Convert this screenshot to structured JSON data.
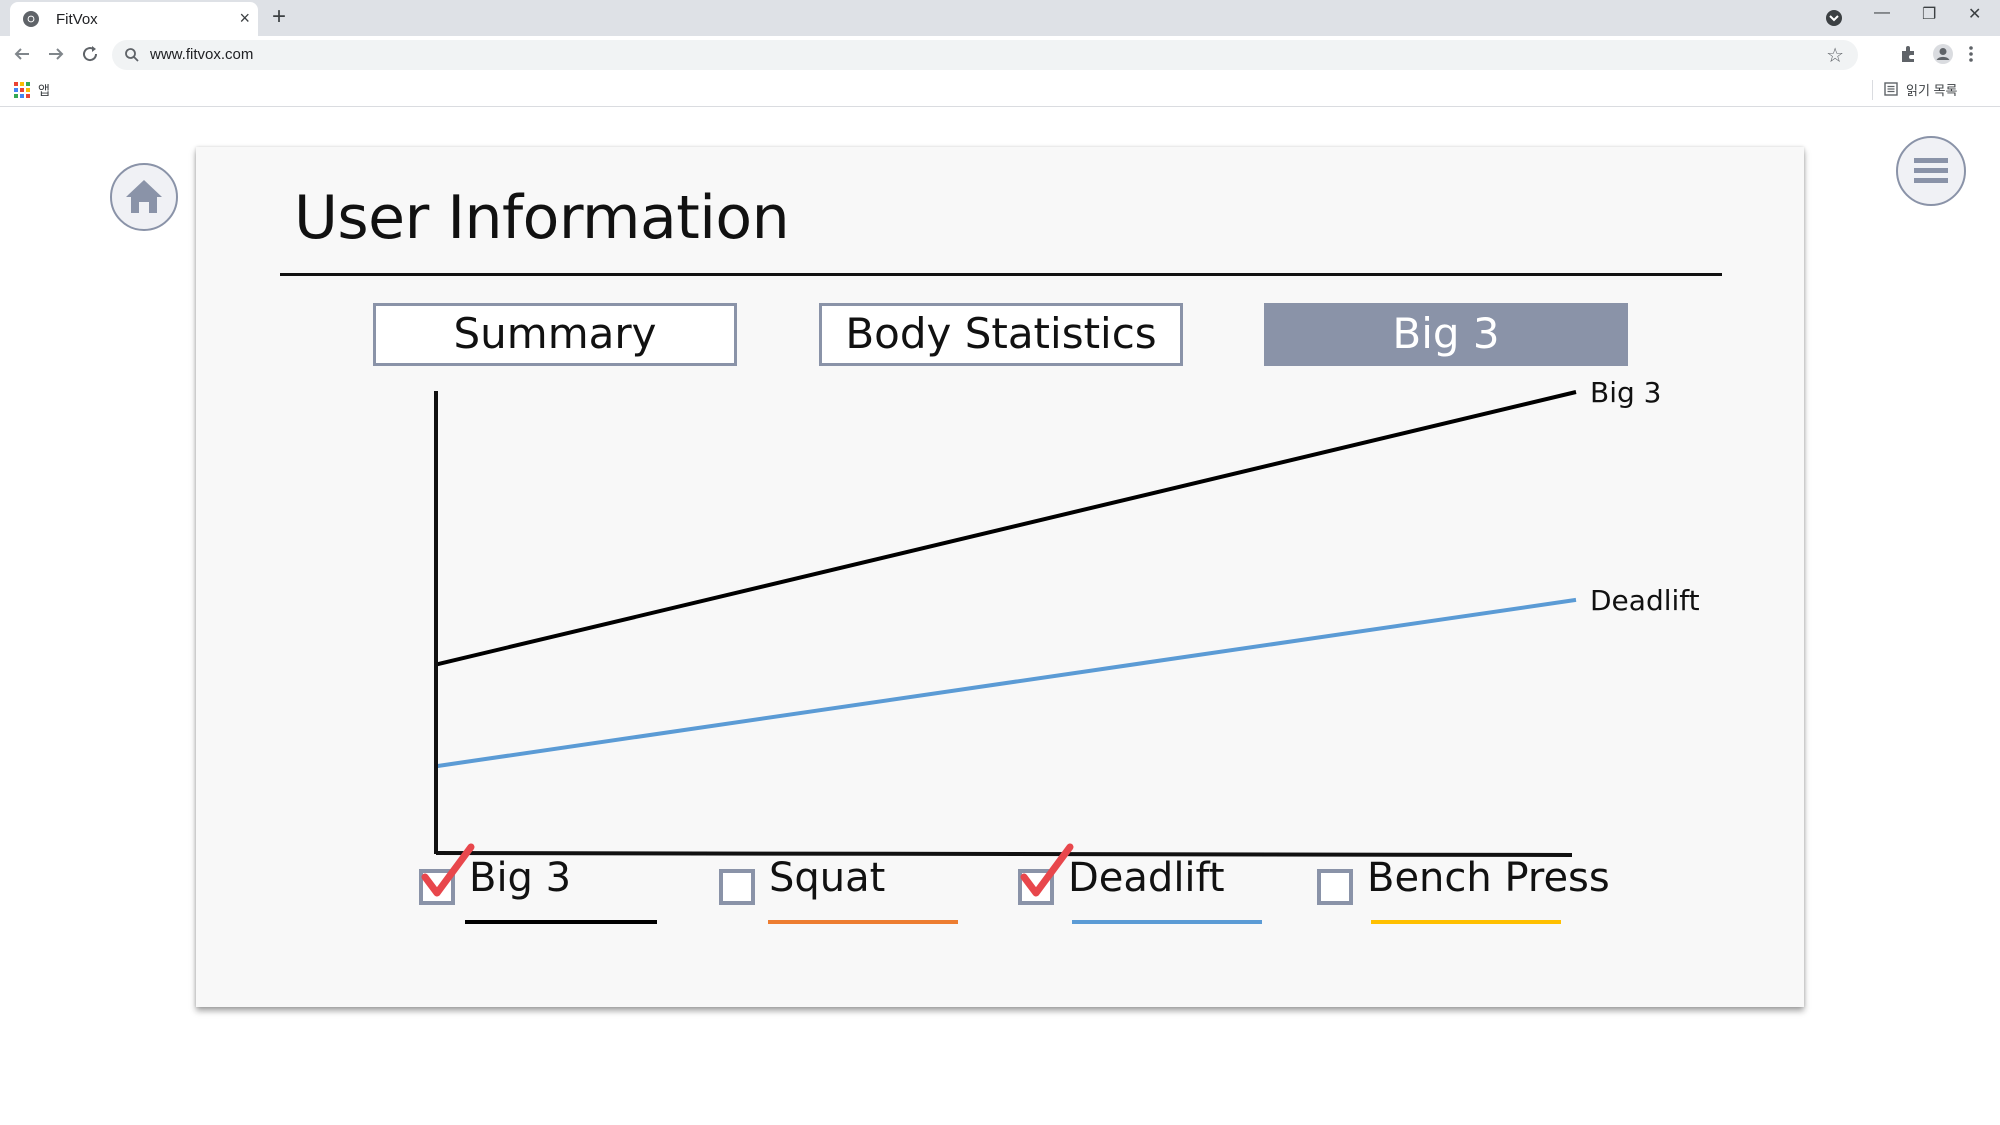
{
  "browser": {
    "tab_title": "FitVox",
    "tab_close": "×",
    "new_tab": "+",
    "url": "www.fitvox.com",
    "bookmarks": {
      "apps_label": "앱",
      "reading_list": "읽기 목록"
    },
    "window_controls": {
      "minimize": "—",
      "restore": "❐",
      "close": "✕"
    }
  },
  "page": {
    "title": "User Information",
    "tabs": [
      {
        "label": "Summary",
        "active": false
      },
      {
        "label": "Body Statistics",
        "active": false
      },
      {
        "label": "Big 3",
        "active": true
      }
    ]
  },
  "chart_data": {
    "type": "line",
    "series": [
      {
        "name": "Big 3",
        "color": "#000000",
        "values": [
          0.41,
          1.0
        ]
      },
      {
        "name": "Deadlift",
        "color": "#5b9bd5",
        "values": [
          0.19,
          0.55
        ]
      }
    ],
    "ylim": [
      0,
      1
    ],
    "xlabel": "",
    "ylabel": "",
    "grid": false
  },
  "legend": [
    {
      "label": "Big 3",
      "color": "#000000",
      "checked": true
    },
    {
      "label": "Squat",
      "color": "#ed7d31",
      "checked": false
    },
    {
      "label": "Deadlift",
      "color": "#5b9bd5",
      "checked": true
    },
    {
      "label": "Bench Press",
      "color": "#ffc000",
      "checked": false
    }
  ],
  "colors": {
    "accent": "#8a93a8",
    "check_mark": "#e8474c",
    "card_background": "#f8f8f8"
  },
  "icons": [
    "home-icon",
    "hamburger-menu-icon",
    "check-mark-icon",
    "chrome-icon",
    "back-arrow-icon",
    "forward-arrow-icon",
    "reload-icon",
    "search-icon",
    "star-icon",
    "extensions-icon",
    "profile-icon",
    "apps-grid-icon",
    "reading-list-icon"
  ]
}
